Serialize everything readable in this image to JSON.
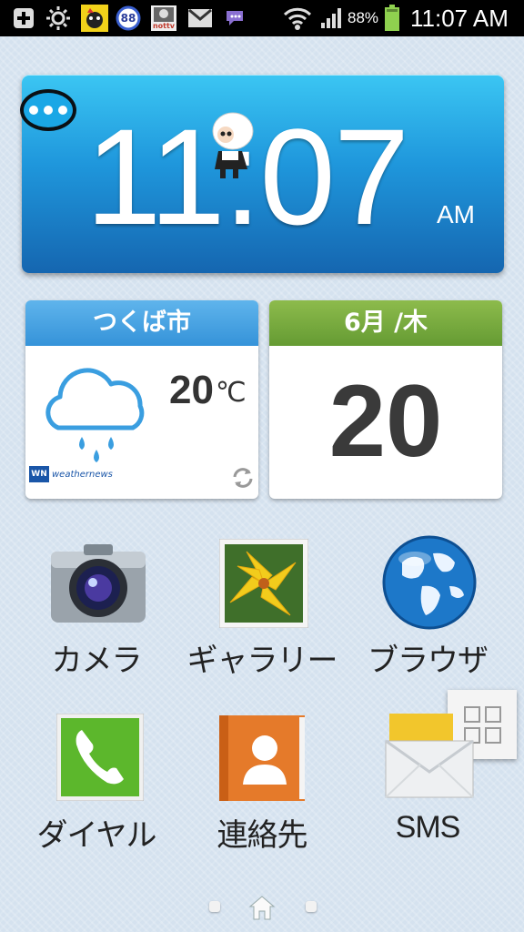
{
  "status_bar": {
    "battery_percent": "88%",
    "time": "11:07 AM",
    "notification_badge": "88",
    "tv_app_label": "nottv",
    "icons": [
      "add-icon",
      "brightness-icon",
      "dog-app-icon",
      "badge-88-icon",
      "tv-app-icon",
      "gmail-icon",
      "chat-icon",
      "wifi-icon",
      "signal-icon",
      "battery-icon"
    ]
  },
  "clock_widget": {
    "time": "11:07",
    "ampm": "AM"
  },
  "weather_widget": {
    "city": "つくば市",
    "temperature": "20",
    "unit": "℃",
    "condition_icon": "rain-cloud-icon",
    "provider": "weathernews",
    "provider_short": "WN"
  },
  "calendar_widget": {
    "month_weekday": "6月 /木",
    "day": "20"
  },
  "apps": [
    {
      "label": "カメラ",
      "icon": "camera-icon"
    },
    {
      "label": "ギャラリー",
      "icon": "gallery-icon"
    },
    {
      "label": "ブラウザ",
      "icon": "browser-globe-icon"
    },
    {
      "label": "ダイヤル",
      "icon": "phone-icon"
    },
    {
      "label": "連絡先",
      "icon": "contacts-icon"
    },
    {
      "label": "SMS",
      "icon": "sms-envelope-icon"
    }
  ],
  "pager": {
    "current": "home",
    "pages": 3
  }
}
